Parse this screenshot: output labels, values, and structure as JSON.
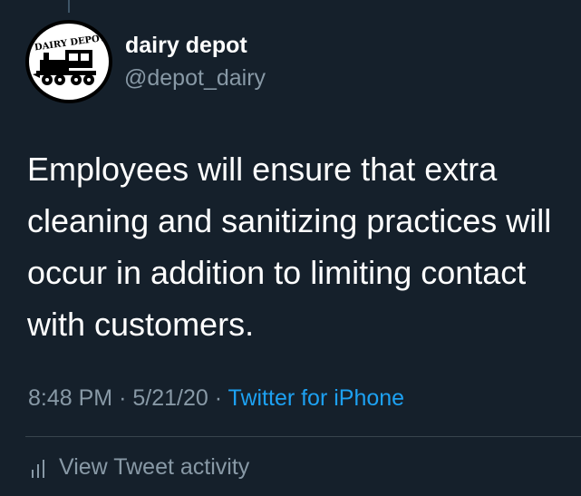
{
  "user": {
    "display_name": "dairy depot",
    "handle": "@depot_dairy",
    "avatar_icon": "dairy-depot-train-logo",
    "avatar_logo_text": "DAIRY DEPOT"
  },
  "tweet": {
    "text": "Employees will ensure that extra cleaning and sanitizing practices will occur in addition to limiting contact with customers."
  },
  "meta": {
    "time": "8:48 PM",
    "separator": "·",
    "date": "5/21/20",
    "source": "Twitter for iPhone"
  },
  "activity": {
    "icon": "bar-chart-icon",
    "label": "View Tweet activity"
  },
  "colors": {
    "background": "#15202b",
    "text_primary": "#ffffff",
    "text_secondary": "#8899a6",
    "link": "#1da1f2",
    "divider": "#38444d"
  }
}
